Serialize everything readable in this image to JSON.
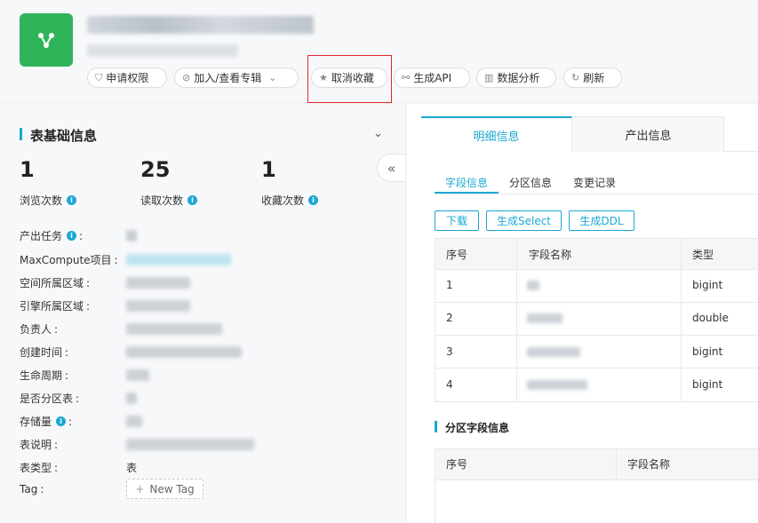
{
  "header": {
    "title": "google_demo_created_tl",
    "subtitle": "prod_demo_create123",
    "buttons": {
      "apply": "申请权限",
      "join": "加入/查看专辑",
      "unfavorite": "取消收藏",
      "gen_api": "生成API",
      "analysis": "数据分析",
      "refresh": "刷新"
    },
    "icons": {
      "logo": "branch-icon",
      "apply": "shield-icon",
      "join": "compass-icon",
      "unfavorite": "star-icon",
      "gen_api": "link-icon",
      "analysis": "chart-icon",
      "refresh": "refresh-icon"
    }
  },
  "left": {
    "section_title": "表基础信息",
    "stats": [
      {
        "value": "1",
        "label": "浏览次数"
      },
      {
        "value": "25",
        "label": "读取次数"
      },
      {
        "value": "1",
        "label": "收藏次数"
      }
    ],
    "rows": {
      "task": "产出任务",
      "project": "MaxCompute项目",
      "space_region": "空间所属区域",
      "engine_region": "引擎所属区域",
      "owner": "负责人",
      "created": "创建时间",
      "lifecycle": "生命周期",
      "partitioned": "是否分区表",
      "storage": "存储量",
      "desc": "表说明",
      "table_type": "表类型",
      "tag": "Tag"
    },
    "table_type_value": "表",
    "new_tag": "New Tag",
    "colon": ":"
  },
  "right": {
    "tabs": [
      "明细信息",
      "产出信息"
    ],
    "subtabs": [
      "字段信息",
      "分区信息",
      "变更记录"
    ],
    "actions": [
      "下载",
      "生成Select",
      "生成DDL"
    ],
    "columns_header": [
      "序号",
      "字段名称",
      "类型"
    ],
    "rows": [
      {
        "no": "1",
        "name": "id",
        "type": "bigint"
      },
      {
        "no": "2",
        "name": "weight",
        "type": "double"
      },
      {
        "no": "3",
        "name": "personid",
        "type": "bigint"
      },
      {
        "no": "4",
        "name": "salesvalid",
        "type": "bigint"
      }
    ],
    "partition_title": "分区字段信息",
    "partition_header": [
      "序号",
      "字段名称"
    ]
  },
  "colors": {
    "accent": "#1ba8d2",
    "logo": "#2fb45a",
    "highlight": "#e3262b"
  }
}
